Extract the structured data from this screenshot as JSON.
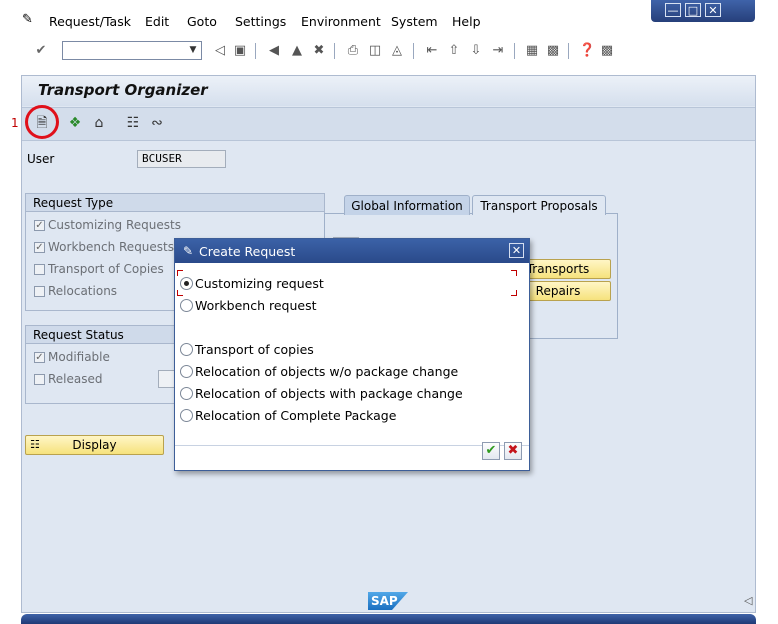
{
  "menubar": {
    "items": [
      "Request/Task",
      "Edit",
      "Goto",
      "Settings",
      "Environment",
      "System",
      "Help"
    ]
  },
  "window_controls": {
    "minimize": "—",
    "maximize": "□",
    "close": "✕"
  },
  "toolbar": {
    "command_field_value": "",
    "icons": [
      "enter-icon",
      "save-icon",
      "back-icon",
      "exit-icon",
      "cancel-icon",
      "print-icon",
      "find-icon",
      "find-next-icon",
      "first-page-icon",
      "previous-page-icon",
      "next-page-icon",
      "last-page-icon",
      "new-session-icon",
      "shortcut-icon",
      "help-icon",
      "customize-layout-icon"
    ]
  },
  "page": {
    "title": "Transport Organizer",
    "marker": "1"
  },
  "app_toolbar": {
    "icons": [
      "create-request-icon",
      "display-object-icon",
      "transport-tools-icon",
      "structure-icon",
      "link-icon"
    ]
  },
  "user": {
    "label": "User",
    "value": "BCUSER"
  },
  "request_type": {
    "heading": "Request Type",
    "options": [
      {
        "label": "Customizing Requests",
        "checked": true
      },
      {
        "label": "Workbench Requests",
        "checked": true
      },
      {
        "label": "Transport of Copies",
        "checked": false
      },
      {
        "label": "Relocations",
        "checked": false
      }
    ]
  },
  "request_status": {
    "heading": "Request Status",
    "options": [
      {
        "label": "Modifiable",
        "checked": true
      },
      {
        "label": "Released",
        "checked": false
      }
    ]
  },
  "display_button": {
    "label": "Display"
  },
  "tabs": {
    "items": [
      {
        "label": "Global Information",
        "active": true
      },
      {
        "label": "Transport Proposals",
        "active": false
      }
    ],
    "buttons": [
      "Transports",
      "Repairs"
    ]
  },
  "dialog": {
    "title": "Create Request",
    "options": [
      {
        "label": "Customizing request",
        "selected": true
      },
      {
        "label": "Workbench request",
        "selected": false
      },
      {
        "label": "Transport of copies",
        "selected": false
      },
      {
        "label": "Relocation of objects w/o package change",
        "selected": false
      },
      {
        "label": "Relocation of objects with package change",
        "selected": false
      },
      {
        "label": "Relocation of Complete Package",
        "selected": false
      }
    ],
    "ok_icon": "checkmark-icon",
    "cancel_icon": "cancel-x-icon"
  },
  "footer": {
    "logo": "SAP"
  },
  "colors": {
    "accent_blue": "#3b62a7",
    "panel_bg": "#dfe7f2",
    "button_yellow": "#f6e27d",
    "highlight_red": "#e0101a"
  }
}
